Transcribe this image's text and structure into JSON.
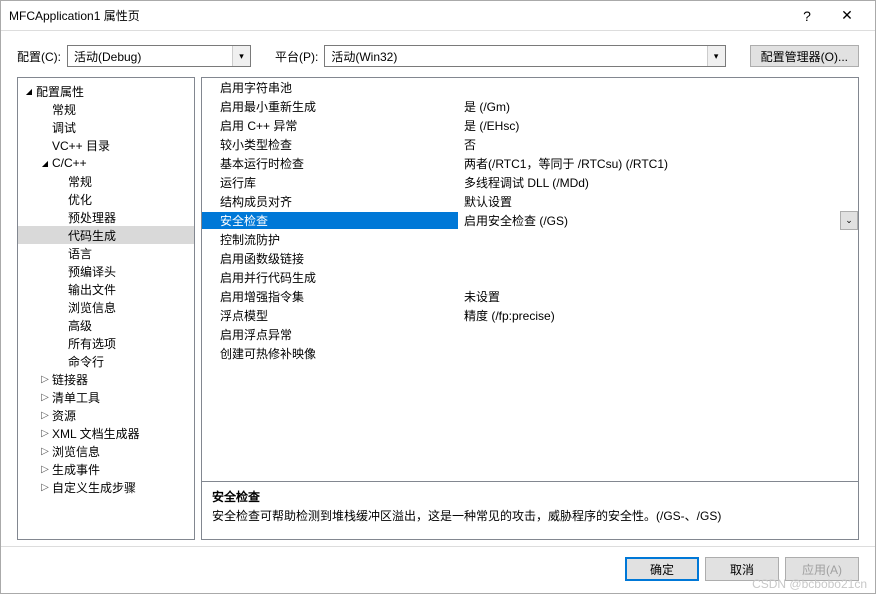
{
  "title": "MFCApplication1 属性页",
  "toolbar": {
    "config_label": "配置(C):",
    "config_value": "活动(Debug)",
    "platform_label": "平台(P):",
    "platform_value": "活动(Win32)",
    "manager_label": "配置管理器(O)..."
  },
  "tree": [
    {
      "label": "配置属性",
      "depth": 0,
      "arrow": "open"
    },
    {
      "label": "常规",
      "depth": 1,
      "arrow": "none"
    },
    {
      "label": "调试",
      "depth": 1,
      "arrow": "none"
    },
    {
      "label": "VC++ 目录",
      "depth": 1,
      "arrow": "none"
    },
    {
      "label": "C/C++",
      "depth": 1,
      "arrow": "open"
    },
    {
      "label": "常规",
      "depth": 2,
      "arrow": "none"
    },
    {
      "label": "优化",
      "depth": 2,
      "arrow": "none"
    },
    {
      "label": "预处理器",
      "depth": 2,
      "arrow": "none"
    },
    {
      "label": "代码生成",
      "depth": 2,
      "arrow": "none",
      "selected": true
    },
    {
      "label": "语言",
      "depth": 2,
      "arrow": "none"
    },
    {
      "label": "预编译头",
      "depth": 2,
      "arrow": "none"
    },
    {
      "label": "输出文件",
      "depth": 2,
      "arrow": "none"
    },
    {
      "label": "浏览信息",
      "depth": 2,
      "arrow": "none"
    },
    {
      "label": "高级",
      "depth": 2,
      "arrow": "none"
    },
    {
      "label": "所有选项",
      "depth": 2,
      "arrow": "none"
    },
    {
      "label": "命令行",
      "depth": 2,
      "arrow": "none"
    },
    {
      "label": "链接器",
      "depth": 1,
      "arrow": "closed"
    },
    {
      "label": "清单工具",
      "depth": 1,
      "arrow": "closed"
    },
    {
      "label": "资源",
      "depth": 1,
      "arrow": "closed"
    },
    {
      "label": "XML 文档生成器",
      "depth": 1,
      "arrow": "closed"
    },
    {
      "label": "浏览信息",
      "depth": 1,
      "arrow": "closed"
    },
    {
      "label": "生成事件",
      "depth": 1,
      "arrow": "closed"
    },
    {
      "label": "自定义生成步骤",
      "depth": 1,
      "arrow": "closed"
    }
  ],
  "grid": [
    {
      "name": "启用字符串池",
      "value": ""
    },
    {
      "name": "启用最小重新生成",
      "value": "是 (/Gm)"
    },
    {
      "name": "启用 C++ 异常",
      "value": "是 (/EHsc)"
    },
    {
      "name": "较小类型检查",
      "value": "否"
    },
    {
      "name": "基本运行时检查",
      "value": "两者(/RTC1，等同于 /RTCsu) (/RTC1)"
    },
    {
      "name": "运行库",
      "value": "多线程调试 DLL (/MDd)"
    },
    {
      "name": "结构成员对齐",
      "value": "默认设置"
    },
    {
      "name": "安全检查",
      "value": "启用安全检查 (/GS)",
      "selected": true
    },
    {
      "name": "控制流防护",
      "value": ""
    },
    {
      "name": "启用函数级链接",
      "value": ""
    },
    {
      "name": "启用并行代码生成",
      "value": ""
    },
    {
      "name": "启用增强指令集",
      "value": "未设置"
    },
    {
      "name": "浮点模型",
      "value": "精度 (/fp:precise)"
    },
    {
      "name": "启用浮点异常",
      "value": ""
    },
    {
      "name": "创建可热修补映像",
      "value": ""
    }
  ],
  "desc": {
    "title": "安全检查",
    "text": "安全检查可帮助检测到堆栈缓冲区溢出，这是一种常见的攻击，威胁程序的安全性。(/GS-、/GS)"
  },
  "footer": {
    "ok": "确定",
    "cancel": "取消",
    "apply": "应用(A)"
  },
  "watermark": "CSDN @bcbobo21cn"
}
